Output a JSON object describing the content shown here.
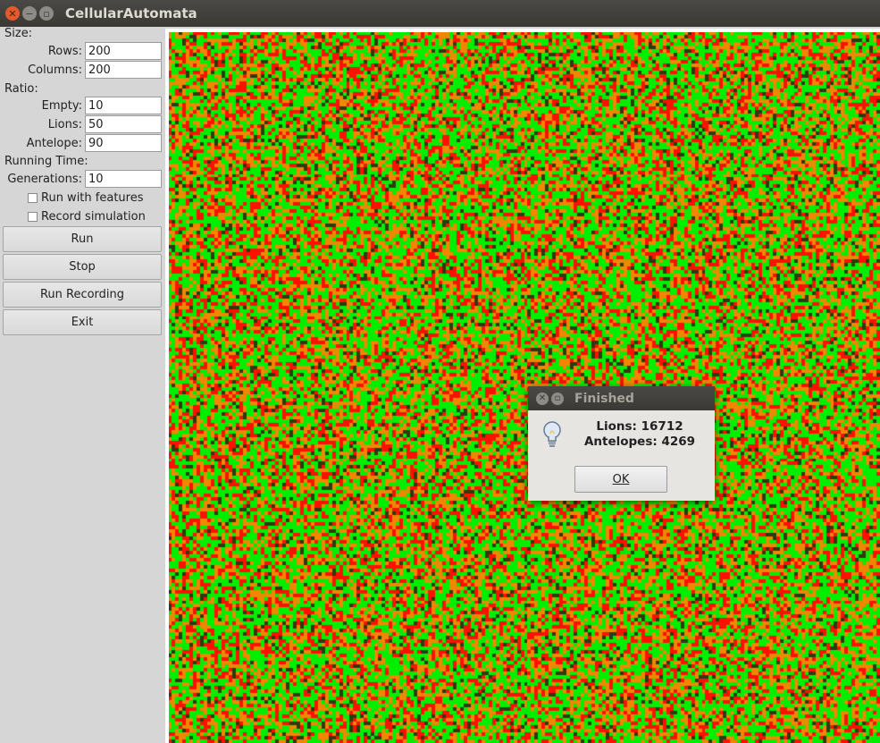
{
  "window": {
    "title": "CellularAutomata"
  },
  "sidebar": {
    "size_label": "Size:",
    "rows_label": "Rows:",
    "rows_value": "200",
    "columns_label": "Columns:",
    "columns_value": "200",
    "ratio_label": "Ratio:",
    "empty_label": "Empty:",
    "empty_value": "10",
    "lions_label": "Lions:",
    "lions_value": "50",
    "antelope_label": "Antelope:",
    "antelope_value": "90",
    "running_time_label": "Running Time:",
    "generations_label": "Generations:",
    "generations_value": "10",
    "run_with_features": {
      "label": "Run with features",
      "checked": false
    },
    "record_simulation": {
      "label": "Record simulation",
      "checked": false
    },
    "buttons": {
      "run": "Run",
      "stop": "Stop",
      "run_recording": "Run Recording",
      "exit": "Exit"
    }
  },
  "grid": {
    "rows": 200,
    "columns": 200,
    "colors": {
      "grass": "#00ee00",
      "lion": "#ff1100",
      "antelope": "#ee8800",
      "dark": "#2f3a10"
    }
  },
  "dialog": {
    "title": "Finished",
    "line1": "Lions: 16712",
    "line2": "Antelopes: 4269",
    "ok_label": "OK",
    "icon": "lightbulb-icon"
  }
}
